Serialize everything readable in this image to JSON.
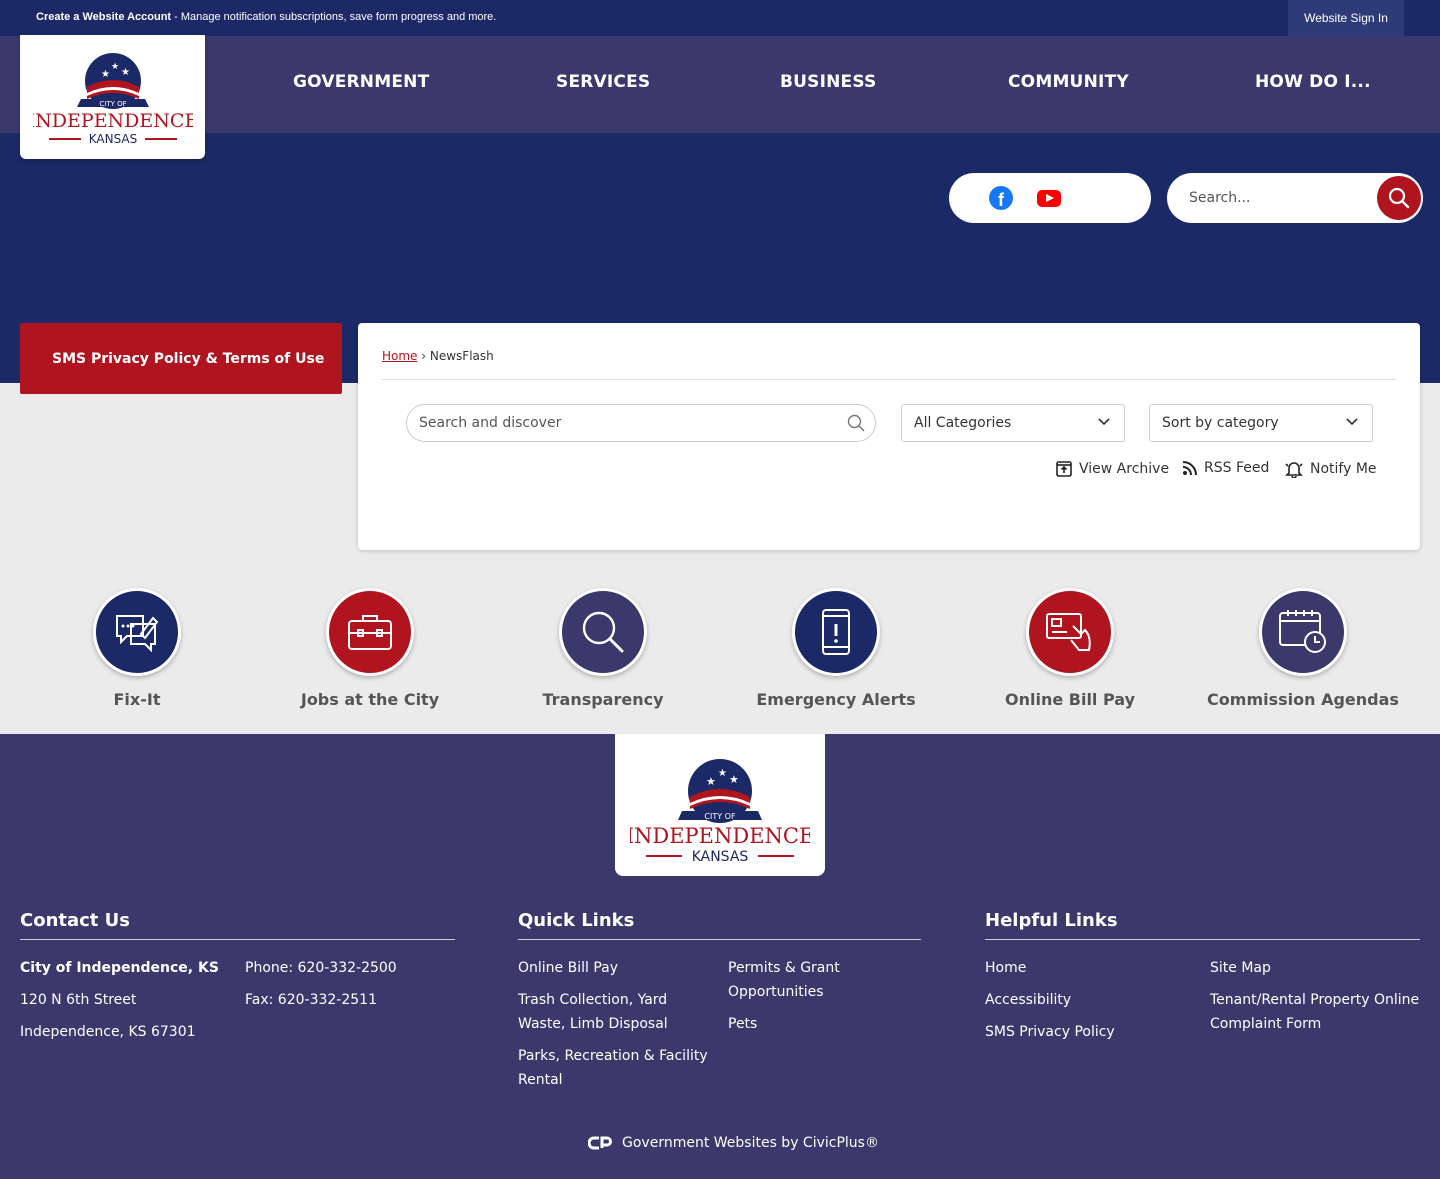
{
  "topbar": {
    "create_account": "Create a Website Account",
    "create_account_desc": " - Manage notification subscriptions, save form progress and more.",
    "sign_in": "Website Sign In"
  },
  "logo": {
    "line1": "CITY OF",
    "line2": "INDEPENDENCE",
    "line3": "KANSAS"
  },
  "nav": [
    "GOVERNMENT",
    "SERVICES",
    "BUSINESS",
    "COMMUNITY",
    "HOW DO I..."
  ],
  "social": {
    "icons": [
      "facebook-icon",
      "youtube-icon"
    ]
  },
  "site_search": {
    "placeholder": "Search..."
  },
  "sms_link": "SMS Privacy Policy & Terms of Use",
  "breadcrumb": {
    "home": "Home",
    "sep": " › ",
    "current": "NewsFlash"
  },
  "newsflash": {
    "search_placeholder": "Search and discover",
    "category": "All Categories",
    "sort": "Sort by category",
    "actions": {
      "archive": "View Archive",
      "rss": "RSS Feed",
      "notify": "Notify Me"
    }
  },
  "quick_links": [
    {
      "label": "Fix-It",
      "icon": "chat-edit-icon",
      "color": "#1b2966"
    },
    {
      "label": "Jobs at the City",
      "icon": "briefcase-icon",
      "color": "#b0141e"
    },
    {
      "label": "Transparency",
      "icon": "magnifier-icon",
      "color": "#3b396b"
    },
    {
      "label": "Emergency Alerts",
      "icon": "phone-alert-icon",
      "color": "#1b2966"
    },
    {
      "label": "Online Bill Pay",
      "icon": "card-pay-icon",
      "color": "#b0141e"
    },
    {
      "label": "Commission Agendas",
      "icon": "calendar-clock-icon",
      "color": "#3b396b"
    }
  ],
  "footer": {
    "contact": {
      "title": "Contact Us",
      "name": "City of Independence, KS",
      "street": "120 N 6th Street",
      "city": "Independence, KS 67301",
      "phone": "Phone: 620-332-2500",
      "fax": "Fax: 620-332-2511"
    },
    "quick": {
      "title": "Quick Links",
      "col1": [
        "Online Bill Pay",
        "Trash Collection, Yard Waste, Limb Disposal",
        "Parks, Recreation & Facility Rental"
      ],
      "col2": [
        "Permits & Grant Opportunities",
        "Pets"
      ]
    },
    "helpful": {
      "title": "Helpful Links",
      "col1": [
        "Home",
        "Accessibility",
        "SMS Privacy Policy"
      ],
      "col2": [
        "Site Map",
        "Tenant/Rental Property Online Complaint Form"
      ]
    },
    "credit": "Government Websites by CivicPlus®"
  },
  "colors": {
    "navy": "#1b2966",
    "purple": "#3b396b",
    "red": "#b0141e"
  }
}
